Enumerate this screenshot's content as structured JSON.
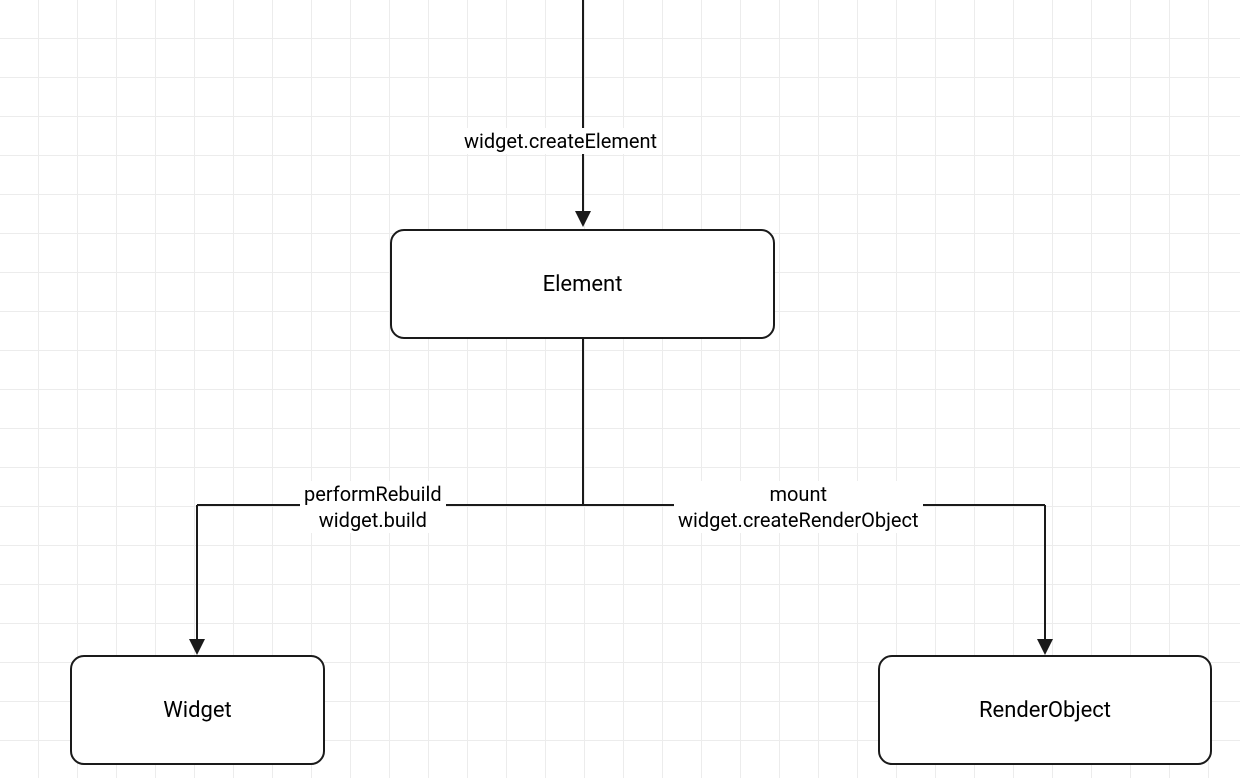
{
  "nodes": {
    "element": {
      "label": "Element"
    },
    "widget": {
      "label": "Widget"
    },
    "renderObject": {
      "label": "RenderObject"
    }
  },
  "edges": {
    "top_to_element": {
      "label": "widget.createElement"
    },
    "element_to_widget": {
      "label": "performRebuild\nwidget.build"
    },
    "element_to_render": {
      "label": "mount\nwidget.createRenderObject"
    }
  }
}
